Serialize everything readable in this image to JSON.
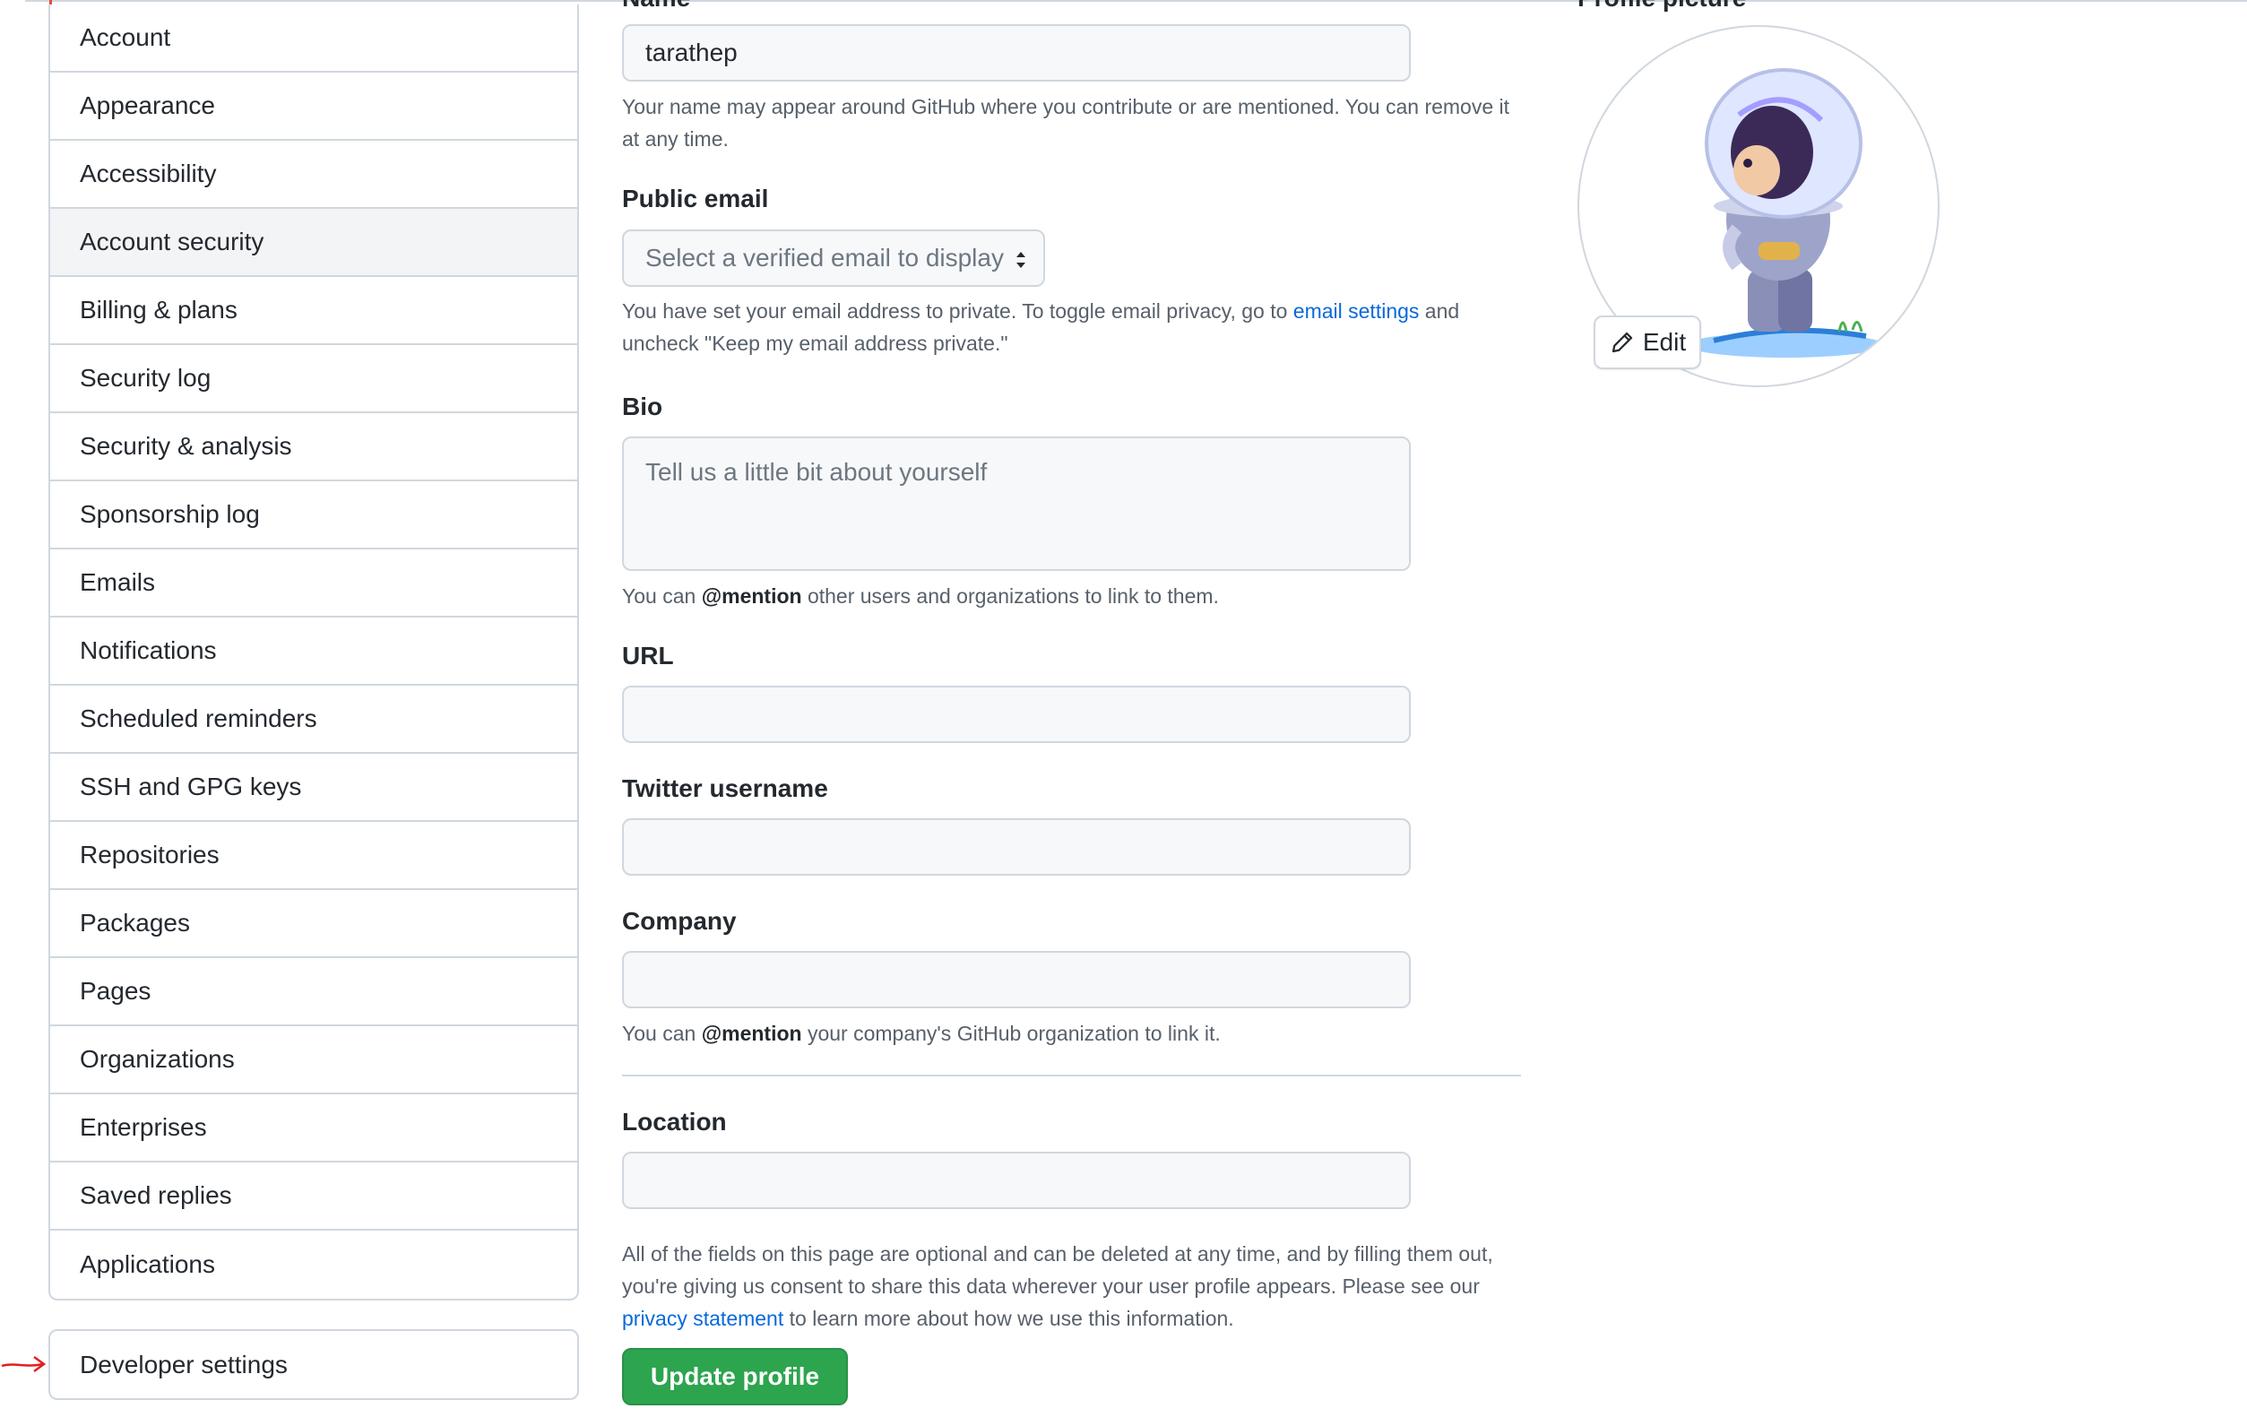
{
  "sidebar": {
    "items": [
      {
        "label": "Account"
      },
      {
        "label": "Appearance"
      },
      {
        "label": "Accessibility"
      },
      {
        "label": "Account security"
      },
      {
        "label": "Billing & plans"
      },
      {
        "label": "Security log"
      },
      {
        "label": "Security & analysis"
      },
      {
        "label": "Sponsorship log"
      },
      {
        "label": "Emails"
      },
      {
        "label": "Notifications"
      },
      {
        "label": "Scheduled reminders"
      },
      {
        "label": "SSH and GPG keys"
      },
      {
        "label": "Repositories"
      },
      {
        "label": "Packages"
      },
      {
        "label": "Pages"
      },
      {
        "label": "Organizations"
      },
      {
        "label": "Enterprises"
      },
      {
        "label": "Saved replies"
      },
      {
        "label": "Applications"
      }
    ],
    "selected": "Account security",
    "developer_settings": "Developer settings"
  },
  "form": {
    "name": {
      "label": "Name",
      "value": "tarathep",
      "note": "Your name may appear around GitHub where you contribute or are mentioned. You can remove it at any time."
    },
    "public_email": {
      "label": "Public email",
      "selected": "Select a verified email to display",
      "note_prefix": "You have set your email address to private. To toggle email privacy, go to",
      "note_link": "email settings",
      "note_suffix": "and uncheck \"Keep my email address private.\""
    },
    "bio": {
      "label": "Bio",
      "placeholder": "Tell us a little bit about yourself",
      "note_prefix": "You can",
      "note_mention": "@mention",
      "note_suffix": "other users and organizations to link to them."
    },
    "url": {
      "label": "URL",
      "value": ""
    },
    "twitter": {
      "label": "Twitter username",
      "value": ""
    },
    "company": {
      "label": "Company",
      "value": "",
      "note_prefix": "You can",
      "note_mention": "@mention",
      "note_suffix": "your company's GitHub organization to link it."
    },
    "location": {
      "label": "Location",
      "value": ""
    },
    "footer_note_prefix": "All of the fields on this page are optional and can be deleted at any time, and by filling them out, you're giving us consent to share this data wherever your user profile appears. Please see our",
    "footer_link": "privacy statement",
    "footer_note_suffix": "to learn more about how we use this information.",
    "submit_label": "Update profile"
  },
  "profile_picture": {
    "label": "Profile picture",
    "edit_label": "Edit",
    "edit_icon": "pencil-icon"
  },
  "colors": {
    "primary_button": "#2da44e",
    "link": "#0969da",
    "annotation_arrow": "#e02020"
  }
}
